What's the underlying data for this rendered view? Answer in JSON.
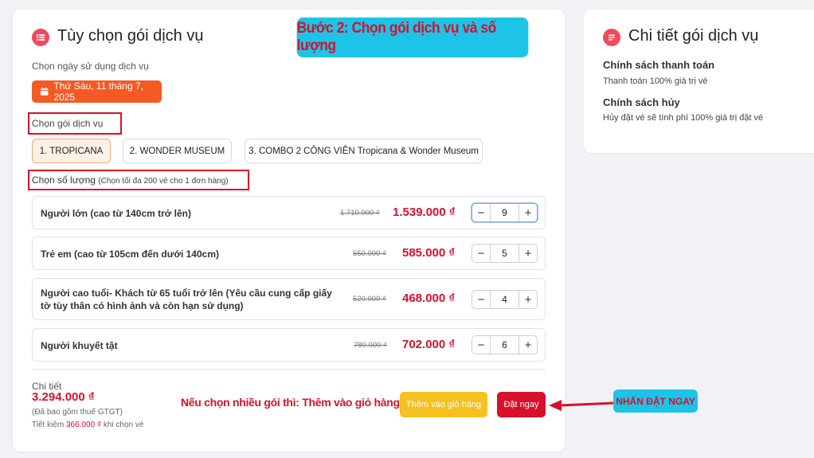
{
  "main": {
    "title": "Tùy chọn gói dịch vụ",
    "step_banner": "Bước 2: Chọn gói dịch vụ và số lượng",
    "date_label": "Chọn ngày sử dụng dịch vụ",
    "date_value": "Thứ Sáu, 11 tháng 7, 2025",
    "package_label": "Chọn gói dịch vụ",
    "packages": [
      {
        "label": "1. TROPICANA",
        "active": true
      },
      {
        "label": "2. WONDER MUSEUM",
        "active": false
      },
      {
        "label": "3. COMBO 2 CÔNG VIÊN Tropicana & Wonder Museum",
        "active": false
      }
    ],
    "qty_label": "Chọn số lượng",
    "qty_hint": "(Chọn tối đa 200 vé cho 1 đơn hàng)",
    "tickets": [
      {
        "name": "Người lớn (cao từ 140cm trở lên)",
        "old_price": "1.710.000 ₫",
        "price": "1.539.000 ₫",
        "qty": "9"
      },
      {
        "name": "Trẻ em (cao từ 105cm đến dưới 140cm)",
        "old_price": "650.000 ₫",
        "price": "585.000 ₫",
        "qty": "5"
      },
      {
        "name": "Người cao tuổi- Khách từ 65 tuổi trở lên (Yêu cầu cung cấp giấy tờ tùy thân có hình ảnh và còn hạn sử dụng)",
        "old_price": "520.000 ₫",
        "price": "468.000 ₫",
        "qty": "4"
      },
      {
        "name": "Người khuyết tật",
        "old_price": "780.000 ₫",
        "price": "702.000 ₫",
        "qty": "6"
      }
    ],
    "minus": "−",
    "plus": "+",
    "summary": {
      "label": "Chi tiết",
      "total": "3.294.000 ₫",
      "vat_note": "(Đã bao gồm thuế GTGT)",
      "save_prefix": "Tiết kiệm",
      "save_amount": "366.000 ₫",
      "save_suffix": "khi chọn vé"
    },
    "note_multi": "Nếu chọn nhiều gói thì: Thêm vào giỏ hàng",
    "add_to_cart": "Thêm vào giỏ hàng",
    "order_now": "Đặt ngay",
    "press_badge": "NHẤN ĐẶT NGAY"
  },
  "side": {
    "title": "Chi tiết gói dịch vụ",
    "payment_heading": "Chính sách thanh toán",
    "payment_text": "Thanh toán 100% giá trị vé",
    "cancel_heading": "Chính sách hủy",
    "cancel_text": "Hủy đặt vé sẽ tính phí 100% giá trị đặt vé"
  },
  "colors": {
    "accent_red": "#d7102b",
    "date_orange": "#f35a24",
    "cart_yellow": "#f5c11f",
    "banner_cyan": "#1ec3e8"
  }
}
